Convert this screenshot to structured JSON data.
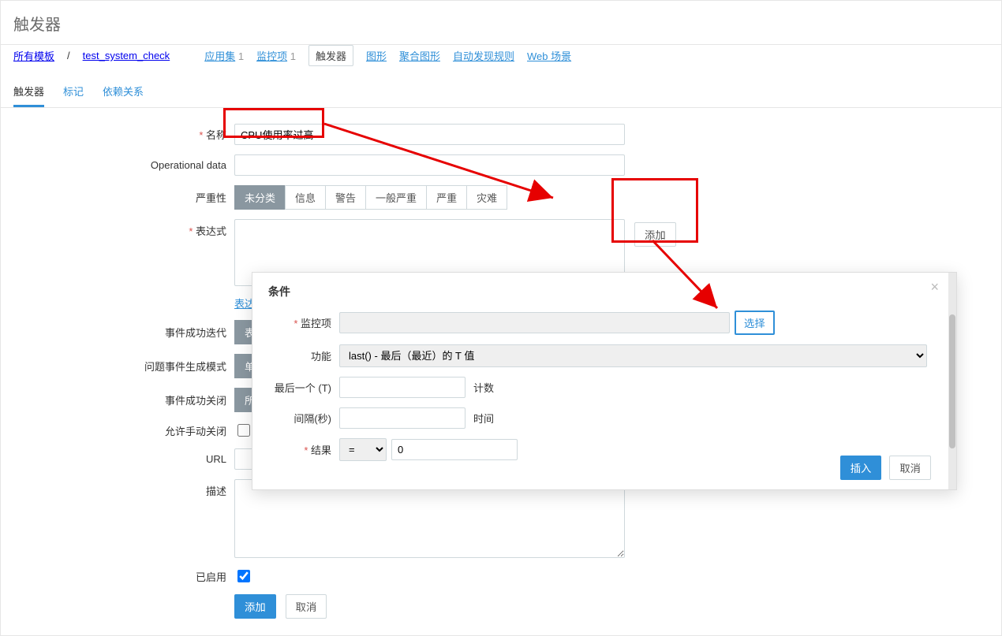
{
  "page_title": "触发器",
  "breadcrumb": {
    "all_templates": "所有模板",
    "template": "test_system_check"
  },
  "nav": {
    "app_set": "应用集",
    "app_set_count": "1",
    "items": "监控项",
    "items_count": "1",
    "triggers": "触发器",
    "graphs": "图形",
    "agg_graphs": "聚合图形",
    "discovery": "自动发现规则",
    "web": "Web 场景"
  },
  "tabs": {
    "trigger": "触发器",
    "tags": "标记",
    "deps": "依赖关系"
  },
  "form": {
    "name_label": "名称",
    "name_value": "CPU使用率过高",
    "op_label": "Operational data",
    "op_value": "",
    "severity_label": "严重性",
    "severity_opts": [
      "未分类",
      "信息",
      "警告",
      "一般严重",
      "严重",
      "灾难"
    ],
    "expr_label": "表达式",
    "expr_value": "",
    "add_btn": "添加",
    "expr_builder": "表达式",
    "ok_iter_label": "事件成功迭代",
    "ok_iter_sel": "表达",
    "gen_mode_label": "问题事件生成模式",
    "gen_mode_sel": "单个",
    "ok_close_label": "事件成功关闭",
    "ok_close_sel": "所有",
    "manual_close_label": "允许手动关闭",
    "url_label": "URL",
    "url_value": "",
    "desc_label": "描述",
    "desc_value": "",
    "enabled_label": "已启用",
    "submit": "添加",
    "cancel": "取消"
  },
  "modal": {
    "title": "条件",
    "item_label": "监控项",
    "item_value": "",
    "select_btn": "选择",
    "func_label": "功能",
    "func_value": "last() - 最后（最近）的 T 值",
    "last_label": "最后一个 (T)",
    "last_value": "",
    "last_suffix": "计数",
    "interval_label": "间隔(秒)",
    "interval_value": "",
    "interval_suffix": "时间",
    "result_label": "结果",
    "result_op": "=",
    "result_value": "0",
    "insert": "插入",
    "cancel": "取消"
  }
}
